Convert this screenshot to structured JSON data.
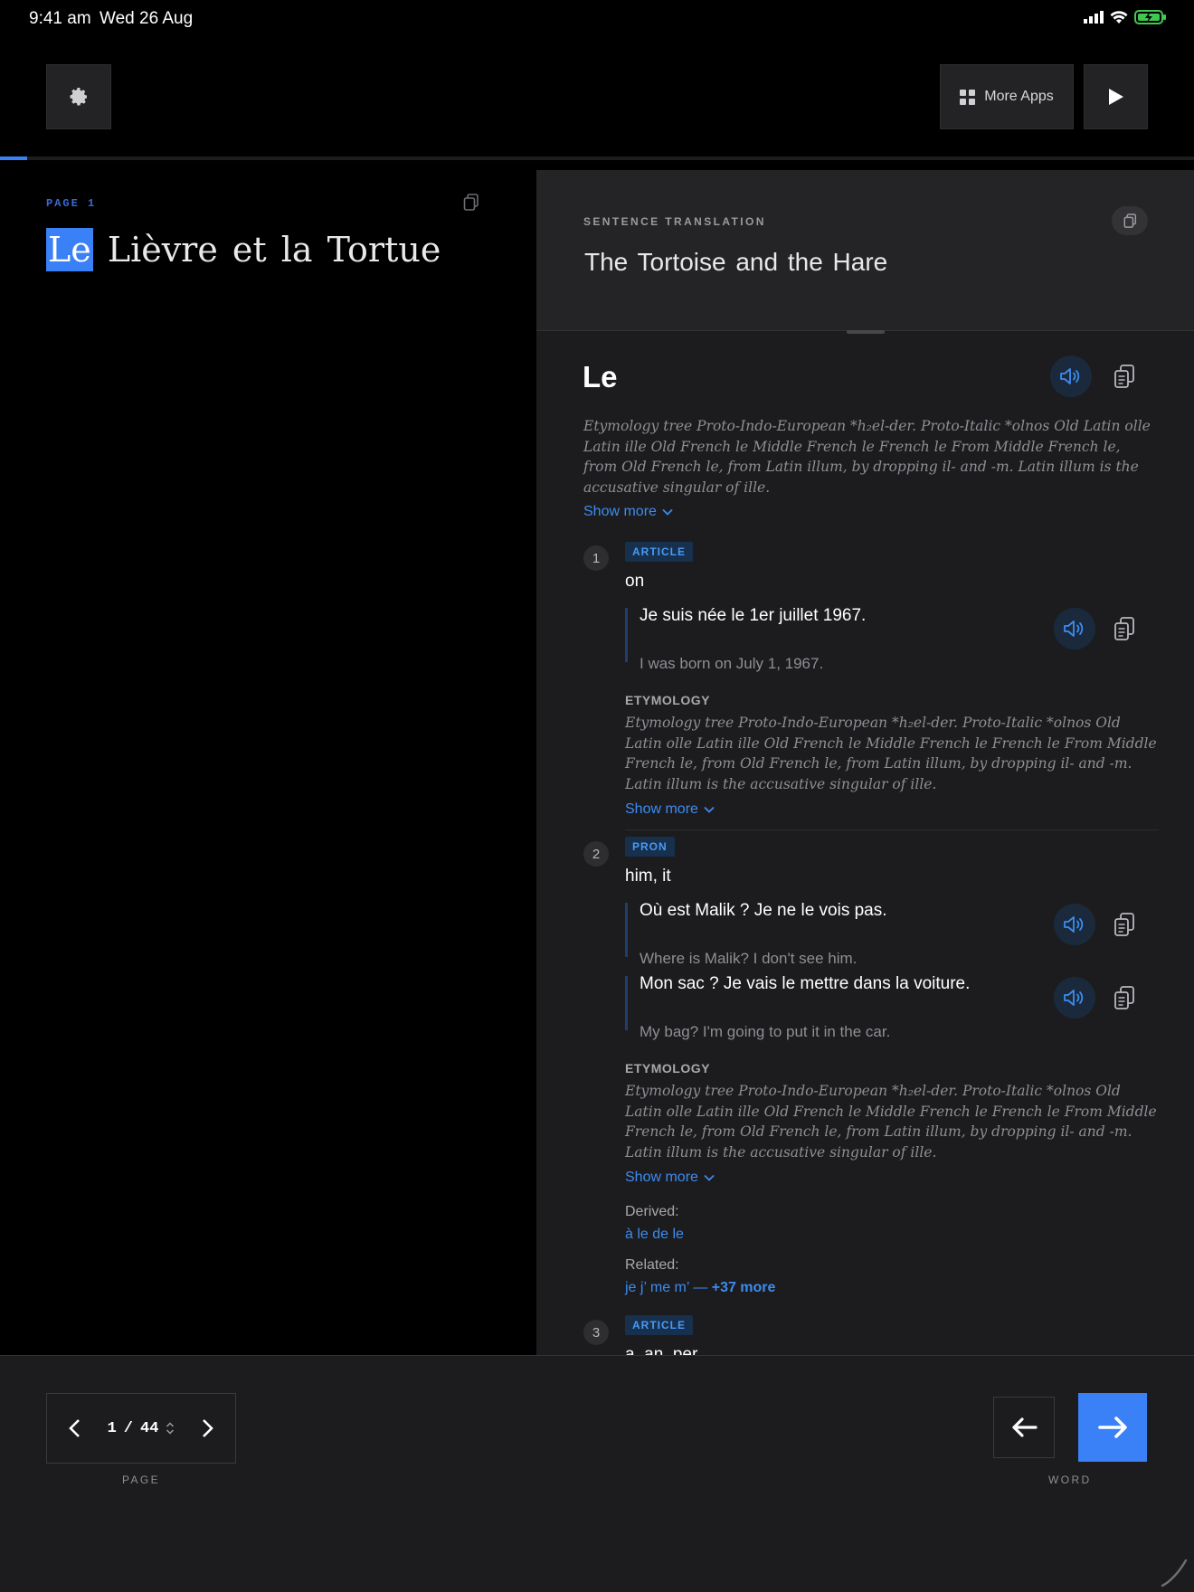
{
  "status_bar": {
    "time": "9:41 am",
    "date": "Wed 26 Aug"
  },
  "toolbar": {
    "more_apps_label": "More Apps",
    "progress": 0.023
  },
  "reader": {
    "page_label": "PAGE 1",
    "highlighted_word": "Le",
    "rest_of_sentence": "Lièvre et la Tortue"
  },
  "translation": {
    "label": "SENTENCE TRANSLATION",
    "text": "The Tortoise and the Hare"
  },
  "entry": {
    "word": "Le",
    "etymology": "Etymology tree Proto-Indo-European *h₂el-der. Proto-Italic *olnos Old Latin olle Latin ille Old French le Middle French le French le From Middle French le, from Old French le, from Latin illum, by dropping il- and -m. Latin illum is the accusative singular of ille.",
    "show_more": "Show more",
    "senses": [
      {
        "num": "1",
        "pos": "ARTICLE",
        "gloss": "on",
        "examples": [
          {
            "fr": "Je suis née le 1er juillet 1967.",
            "en": "I was born on July 1, 1967."
          }
        ],
        "etym_label": "ETYMOLOGY",
        "etymology": "Etymology tree Proto-Indo-European *h₂el-der. Proto-Italic *olnos Old Latin olle Latin ille Old French le Middle French le French le From Middle French le, from Old French le, from Latin illum, by dropping il- and -m. Latin illum is the accusative singular of ille.",
        "show_more": "Show more"
      },
      {
        "num": "2",
        "pos": "PRON",
        "gloss": "him, it",
        "examples": [
          {
            "fr": "Où est Malik ? Je ne le vois pas.",
            "en": "Where is Malik? I don't see him."
          },
          {
            "fr": "Mon sac ? Je vais le mettre dans la voiture.",
            "en": "My bag? I'm going to put it in the car."
          }
        ],
        "etym_label": "ETYMOLOGY",
        "etymology": "Etymology tree Proto-Indo-European *h₂el-der. Proto-Italic *olnos Old Latin olle Latin ille Old French le Middle French le French le From Middle French le, from Old French le, from Latin illum, by dropping il- and -m. Latin illum is the accusative singular of ille.",
        "show_more": "Show more",
        "derived_label": "Derived:",
        "derived": "à le de le",
        "related_label": "Related:",
        "related": "je j’ me m’ —",
        "related_more": "+37 more"
      },
      {
        "num": "3",
        "pos": "ARTICLE",
        "gloss": "a, an, per"
      }
    ]
  },
  "bottom": {
    "current_page": "1",
    "separator": "/",
    "total_pages": "44",
    "page_caption": "PAGE",
    "word_caption": "WORD"
  },
  "colors": {
    "accent": "#3a80f6",
    "link": "#3c8cf0",
    "pane": "#1c1c1e"
  }
}
